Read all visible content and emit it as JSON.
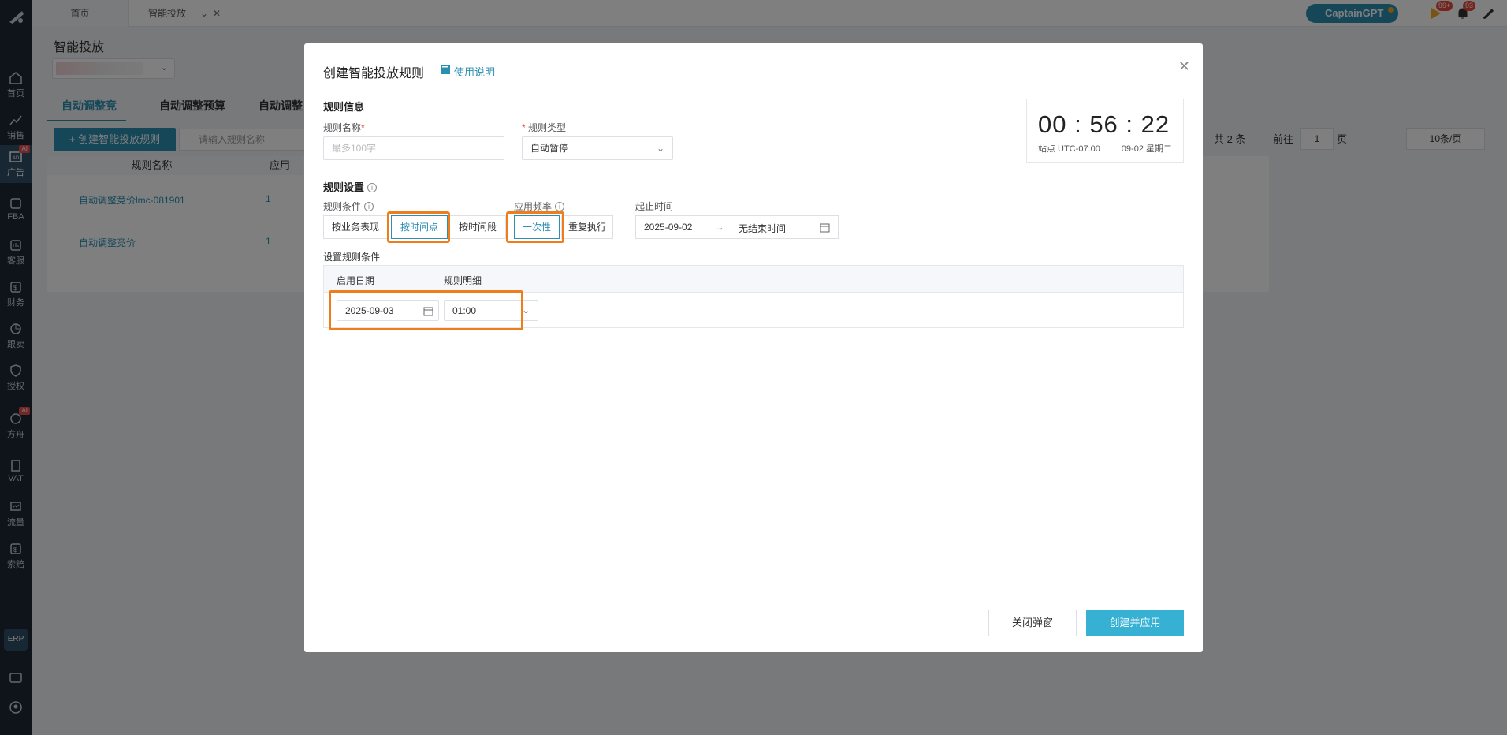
{
  "sidebar": {
    "items": [
      {
        "label": "首页",
        "icon": "home-icon"
      },
      {
        "label": "销售",
        "icon": "chart-line-icon"
      },
      {
        "label": "广告",
        "icon": "ad-icon",
        "tag": "AI"
      },
      {
        "label": "FBA",
        "icon": "box-icon"
      },
      {
        "label": "客服",
        "icon": "service-icon"
      },
      {
        "label": "财务",
        "icon": "dollar-icon"
      },
      {
        "label": "跟卖",
        "icon": "pie-icon"
      },
      {
        "label": "授权",
        "icon": "shield-icon"
      },
      {
        "label": "方舟",
        "icon": "ark-icon",
        "tag": "AI"
      },
      {
        "label": "VAT",
        "icon": "building-icon"
      },
      {
        "label": "流量",
        "icon": "traffic-icon"
      },
      {
        "label": "索赔",
        "icon": "claim-icon"
      }
    ],
    "erp": "ERP"
  },
  "topbar": {
    "tabs": {
      "home": "首页",
      "smart": "智能投放"
    },
    "captain": "CaptainGPT",
    "badge_flag": "99+",
    "badge_bell": "93"
  },
  "page": {
    "title": "智能投放",
    "tabs": [
      "自动调整竞价",
      "自动调整预算",
      "自动调整"
    ],
    "create_button": "+ 创建智能投放规则",
    "search_placeholder": "请输入规则名称",
    "table_headers": {
      "name": "规则名称",
      "apply": "应用"
    },
    "rows": [
      {
        "name": "自动调整竞价lmc-081901",
        "count": "1"
      },
      {
        "name": "自动调整竞价",
        "count": "1"
      }
    ],
    "pager": {
      "total": "共 2 条",
      "goto": "前往",
      "page": "1",
      "unit": "页",
      "size": "10条/页"
    }
  },
  "modal": {
    "title": "创建智能投放规则",
    "help": "使用说明",
    "info_section": "规则信息",
    "name_label": "规则名称",
    "name_placeholder": "最多100字",
    "type_label": "规则类型",
    "type_value": "自动暂停",
    "clock": {
      "time": "00 : 56 : 22",
      "tz": "站点 UTC-07:00",
      "date": "09-02 星期二"
    },
    "settings_section": "规则设置",
    "condition_label": "规则条件",
    "condition_options": [
      "按业务表现",
      "按时间点",
      "按时间段"
    ],
    "frequency_label": "应用频率",
    "frequency_options": [
      "一次性",
      "重复执行"
    ],
    "period_label": "起止时间",
    "period_start": "2025-09-02",
    "period_end": "无结束时间",
    "set_conditions": "设置规则条件",
    "cond_headers": {
      "date": "启用日期",
      "detail": "规则明细"
    },
    "cond_date": "2025-09-03",
    "cond_time": "01:00",
    "btn_close": "关闭弹窗",
    "btn_apply": "创建并应用"
  },
  "colors": {
    "accent": "#2b8fb2",
    "highlight": "#f07d1c",
    "apply": "#36b1d3"
  }
}
